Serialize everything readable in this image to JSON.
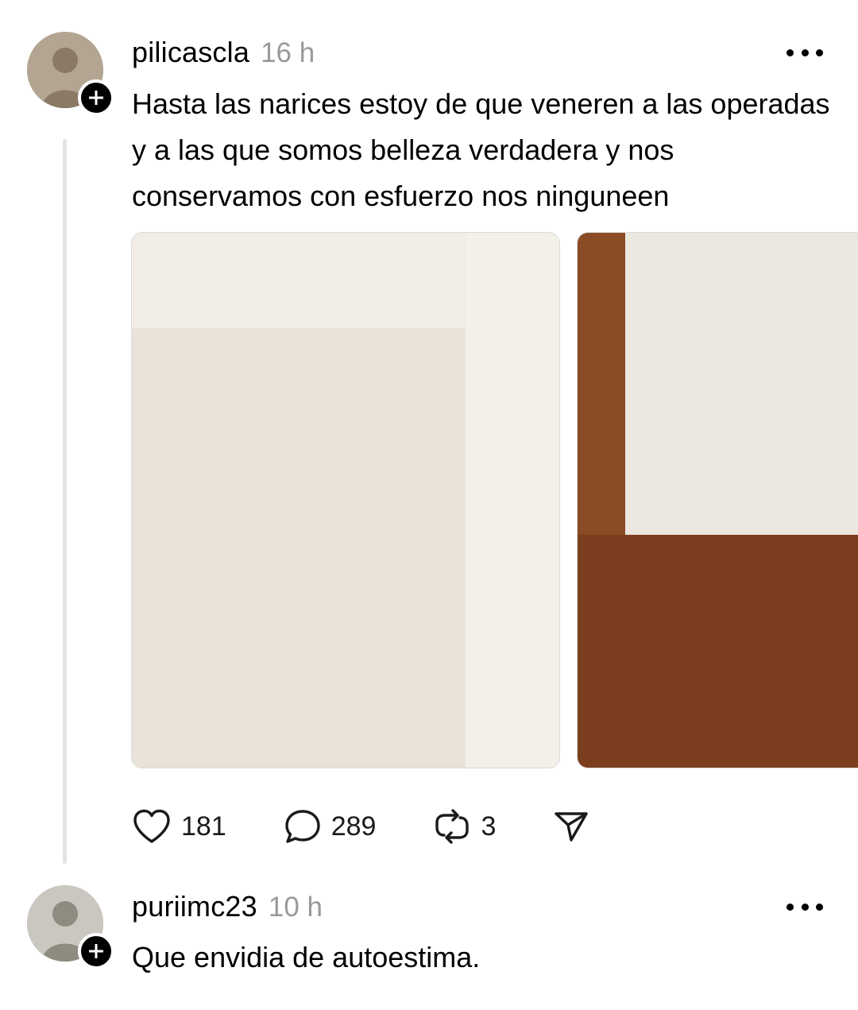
{
  "posts": [
    {
      "username": "pilicascla",
      "timestamp": "16 h",
      "text": "Hasta las narices estoy de que veneren a las operadas y a las que somos belleza verdadera y nos conservamos con esfuerzo nos ninguneen",
      "likes": "181",
      "replies": "289",
      "reposts": "3",
      "media": [
        {
          "kind": "photo",
          "alt": ""
        },
        {
          "kind": "photo",
          "alt": ""
        }
      ]
    },
    {
      "username": "puriimc23",
      "timestamp": "10 h",
      "text": "Que envidia de autoestima."
    }
  ],
  "icons": {
    "like": "heart-icon",
    "reply": "comment-bubble-icon",
    "repost": "repost-icon",
    "share": "send-icon",
    "follow": "plus-icon",
    "menu": "more-icon"
  },
  "colors": {
    "timestamp": "#999999",
    "thread_line": "#e3e3e3",
    "badge": "#000000"
  }
}
